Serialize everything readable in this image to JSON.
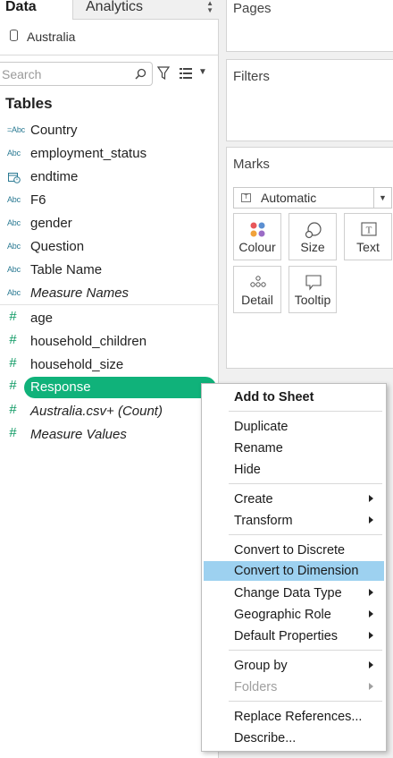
{
  "tabs": {
    "data_label": "Data",
    "analytics_label": "Analytics"
  },
  "datasource": {
    "name": "Australia"
  },
  "search": {
    "placeholder": "Search"
  },
  "tables": {
    "heading": "Tables",
    "dimensions": [
      {
        "type": "=Abc",
        "label": "Country"
      },
      {
        "type": "Abc",
        "label": "employment_status"
      },
      {
        "type": "date",
        "label": "endtime"
      },
      {
        "type": "Abc",
        "label": "F6"
      },
      {
        "type": "Abc",
        "label": "gender"
      },
      {
        "type": "Abc",
        "label": "Question"
      },
      {
        "type": "Abc",
        "label": "Table Name"
      },
      {
        "type": "Abc",
        "label": "Measure Names"
      }
    ],
    "measures": [
      {
        "type": "#",
        "label": "age"
      },
      {
        "type": "#",
        "label": "household_children"
      },
      {
        "type": "#",
        "label": "household_size"
      },
      {
        "type": "#",
        "label": "Response"
      },
      {
        "type": "#",
        "label": "Australia.csv+ (Count)"
      },
      {
        "type": "#",
        "label": "Measure Values"
      }
    ]
  },
  "cards": {
    "pages_title": "Pages",
    "filters_title": "Filters",
    "marks_title": "Marks",
    "mark_type": "Automatic",
    "mark_buttons": [
      "Colour",
      "Size",
      "Text",
      "Detail",
      "Tooltip"
    ]
  },
  "context_menu": {
    "items": [
      "Add to Sheet",
      "Duplicate",
      "Rename",
      "Hide",
      "Create",
      "Transform",
      "Convert to Discrete",
      "Convert to Dimension",
      "Change Data Type",
      "Geographic Role",
      "Default Properties",
      "Group by",
      "Folders",
      "Replace References...",
      "Describe..."
    ]
  },
  "colors": {
    "selected_pill": "#10b27a",
    "menu_highlight": "#9dd1f0",
    "dimension_icon": "#2b7a93",
    "measure_icon": "#0e9a64"
  }
}
